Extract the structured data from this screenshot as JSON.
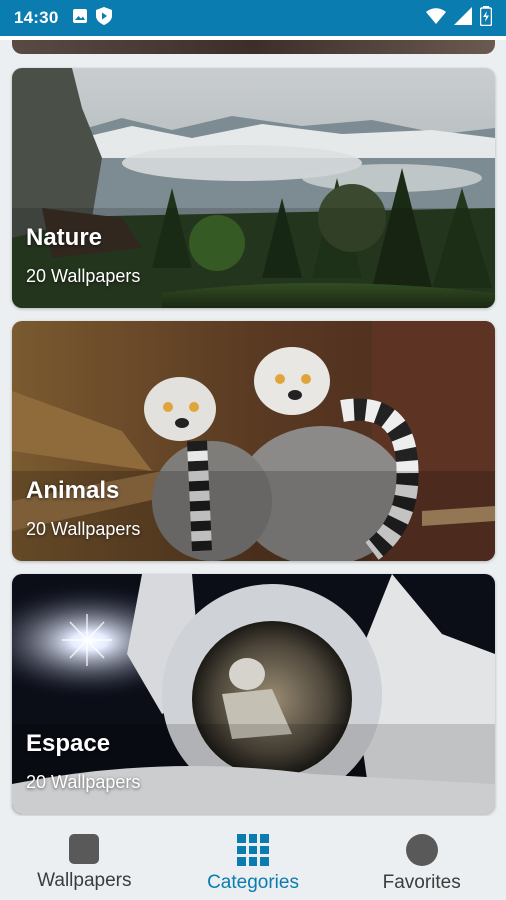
{
  "status_bar": {
    "time": "14:30",
    "background": "#0a7cb0",
    "left_icons": [
      "gallery-icon",
      "play-shield-icon"
    ],
    "right_icons": [
      "wifi-icon",
      "signal-icon",
      "battery-icon"
    ]
  },
  "categories": [
    {
      "title": "Nature",
      "count_label": "20 Wallpapers",
      "image": "mountain-forest-landscape"
    },
    {
      "title": "Animals",
      "count_label": "20 Wallpapers",
      "image": "ring-tailed-lemurs"
    },
    {
      "title": "Espace",
      "count_label": "20 Wallpapers",
      "image": "astronaut-selfie-space"
    }
  ],
  "bottom_nav": {
    "accent": "#0a7cb0",
    "items": [
      {
        "label": "Wallpapers",
        "icon": "square-icon",
        "active": false
      },
      {
        "label": "Categories",
        "icon": "grid-icon",
        "active": true
      },
      {
        "label": "Favorites",
        "icon": "circle-icon",
        "active": false
      }
    ]
  }
}
